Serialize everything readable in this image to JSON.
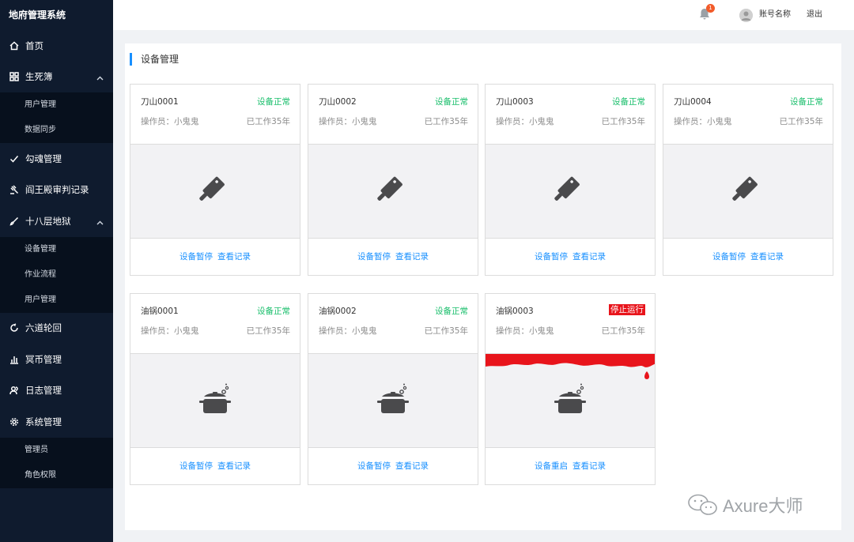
{
  "sidebar": {
    "brand": "地府管理系统",
    "items": [
      {
        "label": "首页"
      },
      {
        "label": "生死簿",
        "sub": [
          "用户管理",
          "数据同步"
        ]
      },
      {
        "label": "勾魂管理"
      },
      {
        "label": "阎王殿审判记录"
      },
      {
        "label": "十八层地狱",
        "sub": [
          "设备管理",
          "作业流程",
          "用户管理"
        ]
      },
      {
        "label": "六道轮回"
      },
      {
        "label": "冥币管理"
      },
      {
        "label": "日志管理"
      },
      {
        "label": "系统管理",
        "sub": [
          "管理员",
          "角色权限"
        ]
      }
    ]
  },
  "topbar": {
    "notification_count": "1",
    "account": "账号名称",
    "logout": "退出"
  },
  "main": {
    "title": "设备管理",
    "cards": [
      {
        "name": "刀山0001",
        "status": "设备正常",
        "operator": "操作员：小鬼鬼",
        "worked": "已工作35年",
        "action1": "设备暂停",
        "action2": "查看记录",
        "icon": "cleaver-icon"
      },
      {
        "name": "刀山0002",
        "status": "设备正常",
        "operator": "操作员：小鬼鬼",
        "worked": "已工作35年",
        "action1": "设备暂停",
        "action2": "查看记录",
        "icon": "cleaver-icon"
      },
      {
        "name": "刀山0003",
        "status": "设备正常",
        "operator": "操作员：小鬼鬼",
        "worked": "已工作35年",
        "action1": "设备暂停",
        "action2": "查看记录",
        "icon": "cleaver-icon"
      },
      {
        "name": "刀山0004",
        "status": "设备正常",
        "operator": "操作员：小鬼鬼",
        "worked": "已工作35年",
        "action1": "设备暂停",
        "action2": "查看记录",
        "icon": "cleaver-icon"
      },
      {
        "name": "油锅0001",
        "status": "设备正常",
        "operator": "操作员：小鬼鬼",
        "worked": "已工作35年",
        "action1": "设备暂停",
        "action2": "查看记录",
        "icon": "pot-icon"
      },
      {
        "name": "油锅0002",
        "status": "设备正常",
        "operator": "操作员：小鬼鬼",
        "worked": "已工作35年",
        "action1": "设备暂停",
        "action2": "查看记录",
        "icon": "pot-icon"
      },
      {
        "name": "油锅0003",
        "status": "停止运行",
        "operator": "操作员：小鬼鬼",
        "worked": "已工作35年",
        "action1": "设备重启",
        "action2": "查看记录",
        "icon": "pot-icon"
      }
    ]
  },
  "colors": {
    "sidebar_bg": "#0f1b2e",
    "accent": "#1890ff",
    "status_ok": "#19be6b",
    "status_stopped": "#e8141b"
  },
  "watermark": "Axure大师"
}
